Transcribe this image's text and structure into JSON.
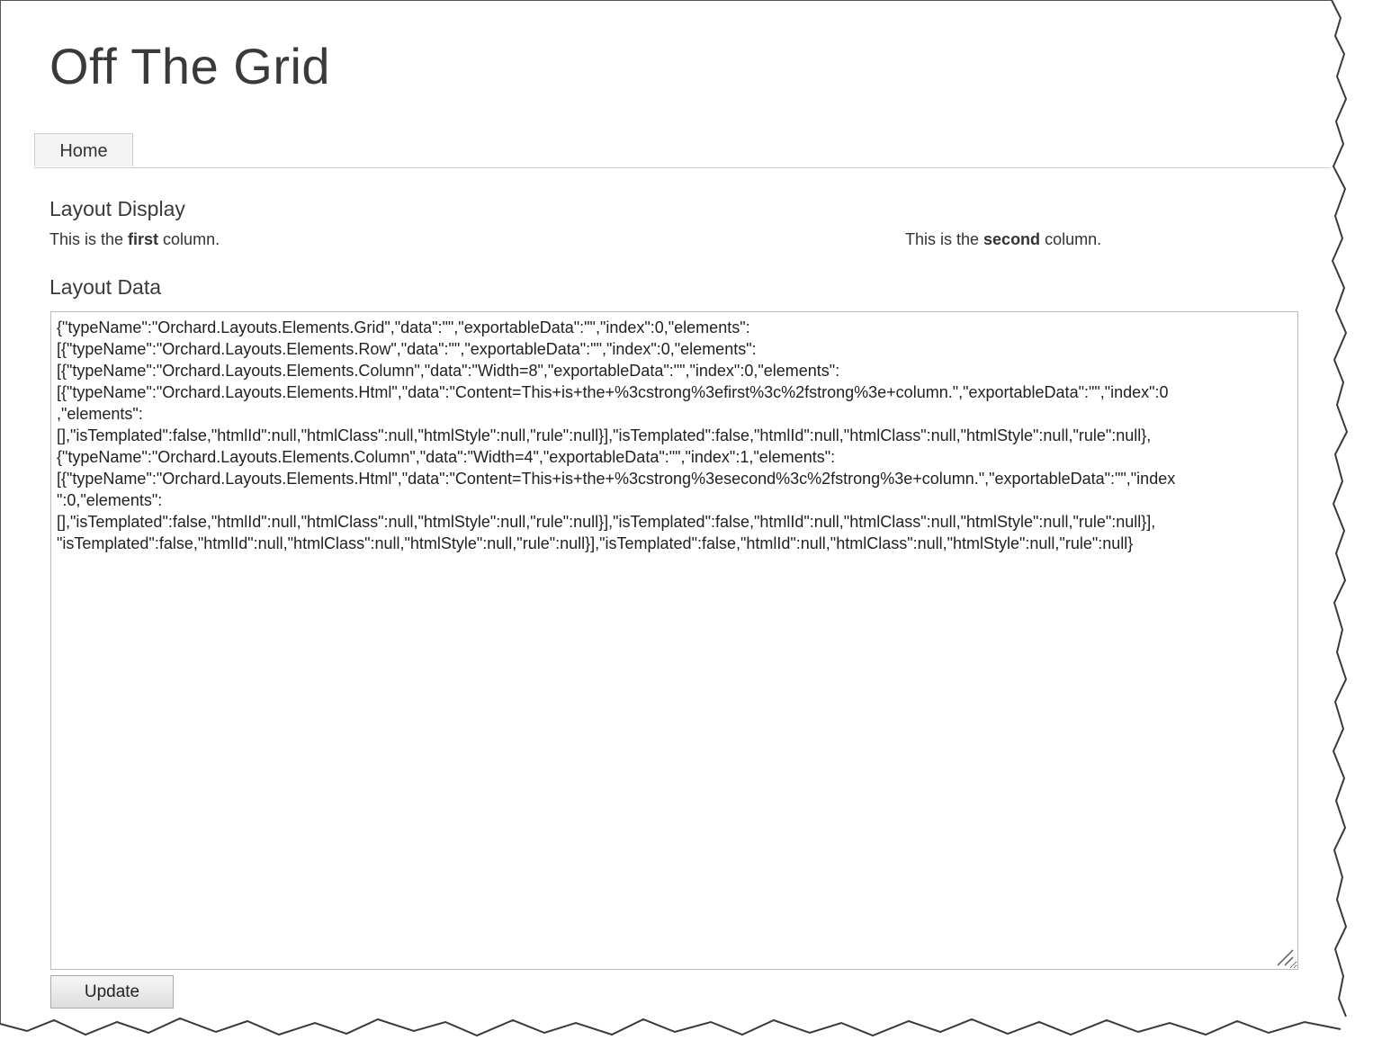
{
  "site": {
    "title": "Off The Grid"
  },
  "nav": {
    "items": [
      {
        "label": "Home"
      }
    ]
  },
  "layout_display": {
    "heading": "Layout Display",
    "first_column": {
      "prefix": "This is the ",
      "strong": "first",
      "suffix": " column."
    },
    "second_column": {
      "prefix": "This is the ",
      "strong": "second",
      "suffix": " column."
    }
  },
  "layout_data": {
    "heading": "Layout Data",
    "value": "{\"typeName\":\"Orchard.Layouts.Elements.Grid\",\"data\":\"\",\"exportableData\":\"\",\"index\":0,\"elements\":\n[{\"typeName\":\"Orchard.Layouts.Elements.Row\",\"data\":\"\",\"exportableData\":\"\",\"index\":0,\"elements\":\n[{\"typeName\":\"Orchard.Layouts.Elements.Column\",\"data\":\"Width=8\",\"exportableData\":\"\",\"index\":0,\"elements\":\n[{\"typeName\":\"Orchard.Layouts.Elements.Html\",\"data\":\"Content=This+is+the+%3cstrong%3efirst%3c%2fstrong%3e+column.\",\"exportableData\":\"\",\"index\":0\n,\"elements\":\n[],\"isTemplated\":false,\"htmlId\":null,\"htmlClass\":null,\"htmlStyle\":null,\"rule\":null}],\"isTemplated\":false,\"htmlId\":null,\"htmlClass\":null,\"htmlStyle\":null,\"rule\":null},\n{\"typeName\":\"Orchard.Layouts.Elements.Column\",\"data\":\"Width=4\",\"exportableData\":\"\",\"index\":1,\"elements\":\n[{\"typeName\":\"Orchard.Layouts.Elements.Html\",\"data\":\"Content=This+is+the+%3cstrong%3esecond%3c%2fstrong%3e+column.\",\"exportableData\":\"\",\"index\n\":0,\"elements\":\n[],\"isTemplated\":false,\"htmlId\":null,\"htmlClass\":null,\"htmlStyle\":null,\"rule\":null}],\"isTemplated\":false,\"htmlId\":null,\"htmlClass\":null,\"htmlStyle\":null,\"rule\":null}],\n\"isTemplated\":false,\"htmlId\":null,\"htmlClass\":null,\"htmlStyle\":null,\"rule\":null}],\"isTemplated\":false,\"htmlId\":null,\"htmlClass\":null,\"htmlStyle\":null,\"rule\":null}"
  },
  "update_button": {
    "label": "Update"
  },
  "icons": {
    "resize_grip": "resize-grip-icon"
  }
}
